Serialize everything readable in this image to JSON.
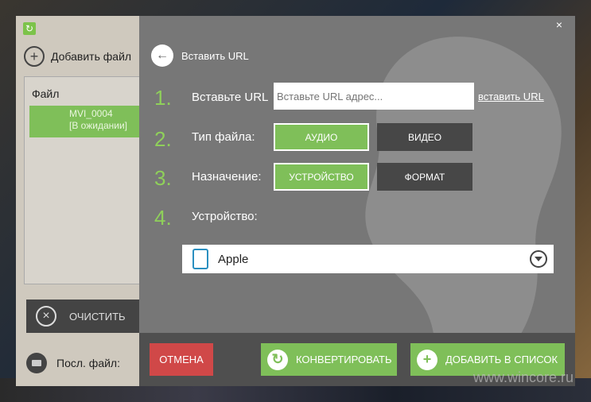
{
  "left_panel": {
    "add_file_label": "Добавить файл",
    "file_list_header": "Файл",
    "file_item": {
      "name": "MVI_0004",
      "status": "[В ожидании]"
    },
    "clear_label": "ОЧИСТИТЬ",
    "last_file_label": "Посл. файл:"
  },
  "dialog": {
    "close_glyph": "×",
    "back_label": "Вставить URL",
    "steps": [
      {
        "num": "1.",
        "label": "Вставьте URL"
      },
      {
        "num": "2.",
        "label": "Тип файла:"
      },
      {
        "num": "3.",
        "label": "Назначение:"
      },
      {
        "num": "4.",
        "label": "Устройство:"
      }
    ],
    "url_placeholder": "Вставьте URL адрес...",
    "paste_link": "вставить URL",
    "file_type": {
      "audio": "АУДИО",
      "video": "ВИДЕО",
      "selected": "АУДИО"
    },
    "destination": {
      "device": "УСТРОЙСТВО",
      "format": "ФОРМАТ",
      "selected": "УСТРОЙСТВО"
    },
    "device_selected": "Apple"
  },
  "bottom_bar": {
    "cancel": "ОТМЕНА",
    "convert": "КОНВЕРТИРОВАТЬ",
    "add_to_list": "ДОБАВИТЬ В СПИСОК"
  },
  "watermark": "www.wincore.ru",
  "colors": {
    "accent_green": "#7fbf59",
    "cancel_red": "#d04848",
    "dialog_gray": "#777777",
    "step_number": "#8fd05a"
  }
}
